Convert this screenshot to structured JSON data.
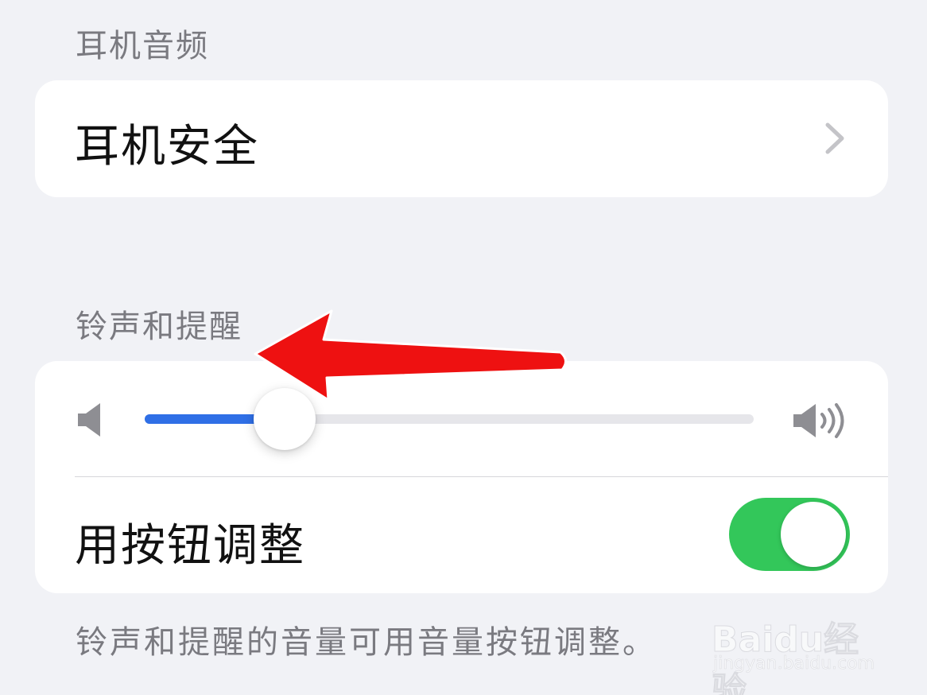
{
  "sections": {
    "headphone_audio": {
      "header": "耳机音频",
      "headphone_safety_label": "耳机安全"
    },
    "ringer_alerts": {
      "header": "铃声和提醒",
      "volume_level": 0.23,
      "change_with_buttons_label": "用按钮调整",
      "change_with_buttons_on": true,
      "footer": "铃声和提醒的音量可用音量按钮调整。"
    }
  },
  "colors": {
    "slider_fill": "#2f6fe6",
    "toggle_on": "#33c75a",
    "annotation_arrow": "#ee1111"
  },
  "icons": {
    "chevron": "chevron-right-icon",
    "volume_min": "speaker-low-icon",
    "volume_max": "speaker-high-icon"
  },
  "watermark": {
    "brand": "Baidu经验",
    "url": "jingyan.baidu.com"
  }
}
